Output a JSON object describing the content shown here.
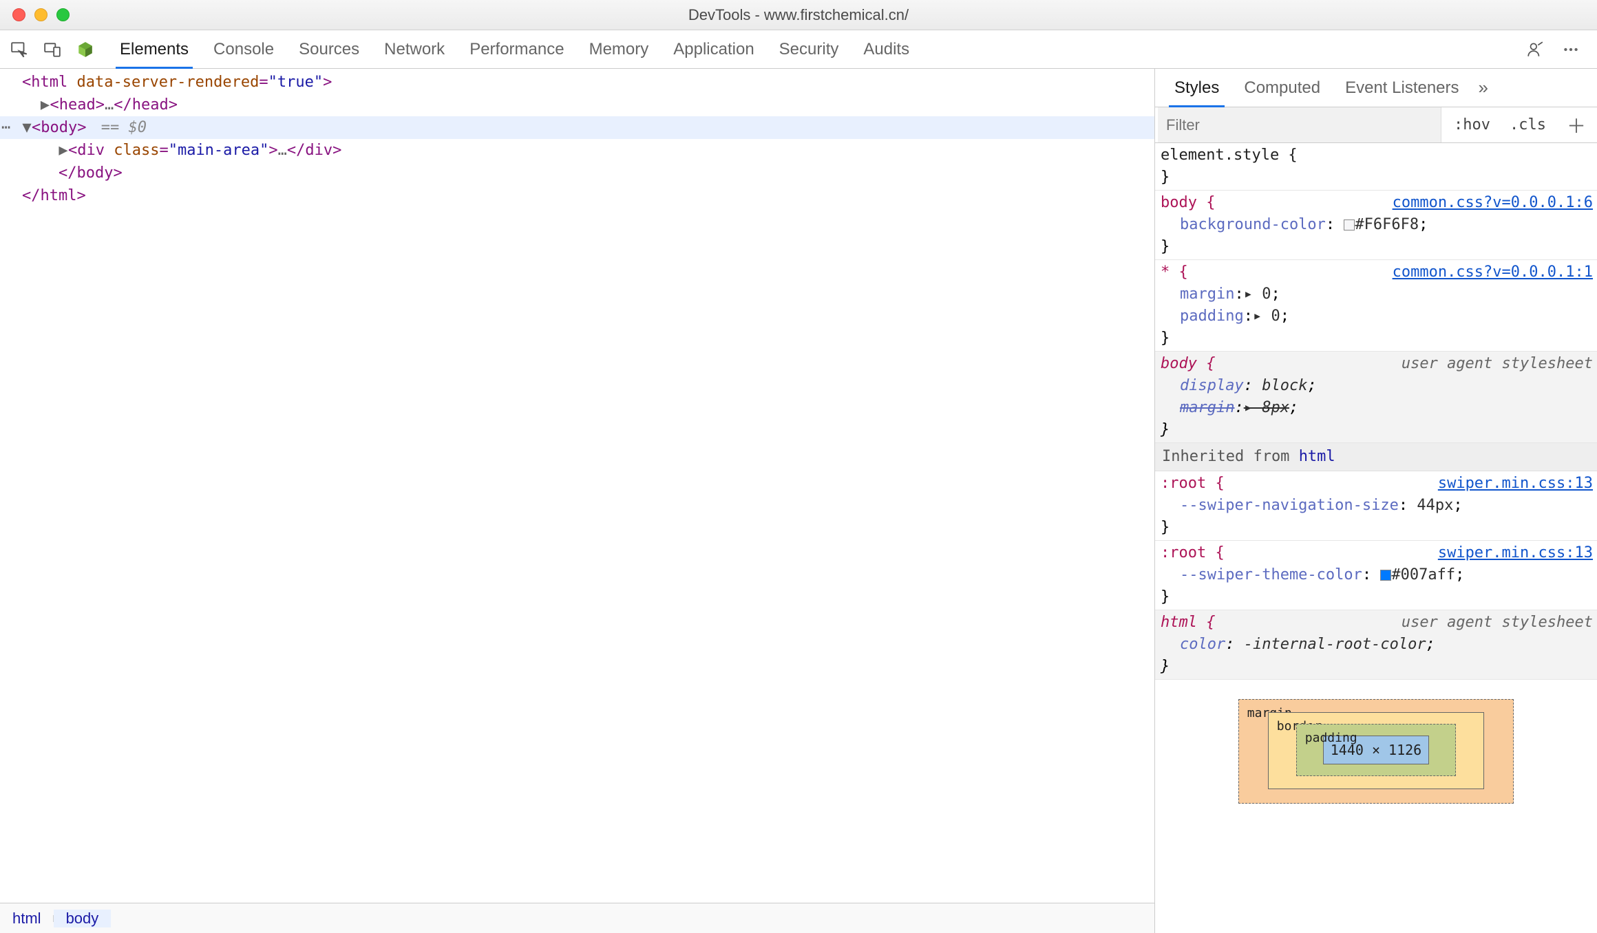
{
  "title": "DevTools - www.firstchemical.cn/",
  "tabs": [
    "Elements",
    "Console",
    "Sources",
    "Network",
    "Performance",
    "Memory",
    "Application",
    "Security",
    "Audits"
  ],
  "activeTab": 0,
  "dom": {
    "l1_open": "<html ",
    "l1_attr_n": "data-server-rendered",
    "l1_attr_v": "\"true\"",
    "l1_close": ">",
    "head_open": "<head>",
    "head_ell": "…",
    "head_close": "</head>",
    "body_open": "<body>",
    "body_sel": " == $0",
    "div_open": "<div ",
    "div_attr_n": "class",
    "div_attr_v": "\"main-area\"",
    "div_mid": ">",
    "div_ell": "…",
    "div_close": "</div>",
    "body_close": "</body>",
    "html_close": "</html>"
  },
  "crumbs": [
    "html",
    "body"
  ],
  "subtabs": [
    "Styles",
    "Computed",
    "Event Listeners"
  ],
  "activeSubtab": 0,
  "filter": {
    "placeholder": "Filter",
    "hov": ":hov",
    "cls": ".cls"
  },
  "rules": {
    "r0": {
      "sel": "element.style {",
      "close": "}"
    },
    "r1": {
      "sel": "body {",
      "src": "common.css?v=0.0.0.1:6",
      "prop1_n": "background-color",
      "prop1_v": "#F6F6F8",
      "swatch": "#F6F6F8",
      "close": "}"
    },
    "r2": {
      "sel": "* {",
      "src": "common.css?v=0.0.0.1:1",
      "p1n": "margin",
      "p1v": "▸ 0",
      "p2n": "padding",
      "p2v": "▸ 0",
      "close": "}"
    },
    "r3": {
      "sel": "body {",
      "src": "user agent stylesheet",
      "p1n": "display",
      "p1v": "block",
      "p2n": "margin",
      "p2v": "▸ 8px",
      "close": "}"
    },
    "inherit": {
      "label": "Inherited from ",
      "from": "html"
    },
    "r4": {
      "sel": ":root {",
      "src": "swiper.min.css:13",
      "p1n": "--swiper-navigation-size",
      "p1v": "44px",
      "close": "}"
    },
    "r5": {
      "sel": ":root {",
      "src": "swiper.min.css:13",
      "p1n": "--swiper-theme-color",
      "p1v": "#007aff",
      "swatch": "#007aff",
      "close": "}"
    },
    "r6": {
      "sel": "html {",
      "src": "user agent stylesheet",
      "p1n": "color",
      "p1v": "-internal-root-color",
      "close": "}"
    }
  },
  "boxmodel": {
    "margin": "margin",
    "margin_top": "-",
    "border": "border",
    "border_top": "-",
    "padding": "padding",
    "content": "1440 × 1126"
  }
}
